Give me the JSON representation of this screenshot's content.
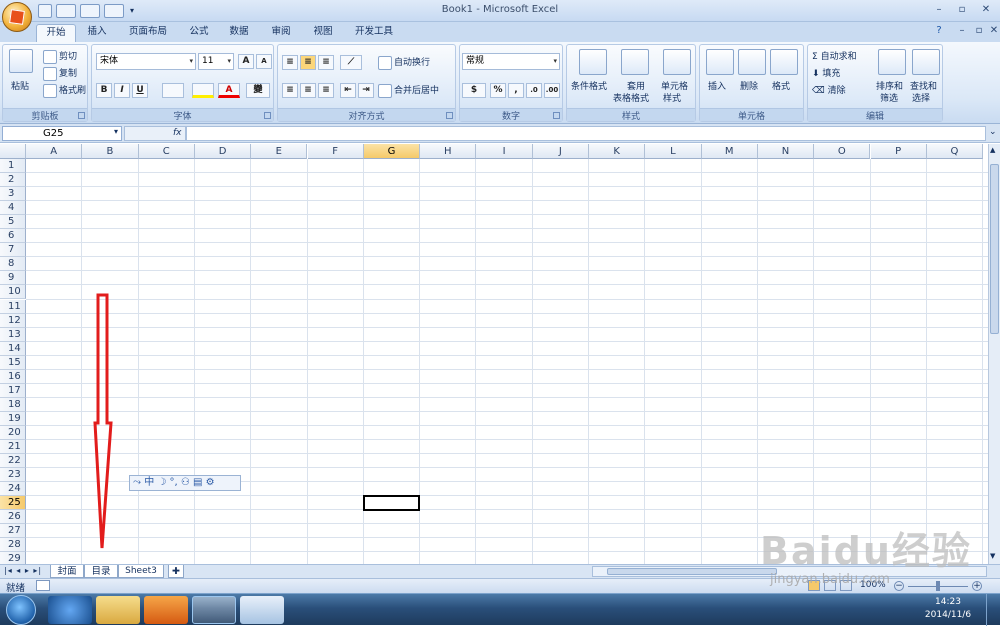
{
  "window": {
    "title": "Book1 - Microsoft Excel"
  },
  "tabs": [
    "开始",
    "插入",
    "页面布局",
    "公式",
    "数据",
    "审阅",
    "视图",
    "开发工具"
  ],
  "clipboard": {
    "paste": "粘贴",
    "cut": "剪切",
    "copy": "复制",
    "format_painter": "格式刷",
    "label": "剪贴板"
  },
  "font": {
    "name": "宋体",
    "size": "11",
    "bold": "B",
    "italic": "I",
    "underline": "U",
    "label": "字体",
    "pinyin": "變"
  },
  "alignment": {
    "wrap": "自动换行",
    "merge": "合并后居中",
    "label": "对齐方式"
  },
  "number": {
    "format": "常规",
    "percent": "%",
    "comma": ",",
    "label": "数字"
  },
  "styles": {
    "conditional": "条件格式",
    "table_format_1": "套用",
    "table_format_2": "表格格式",
    "cell_style_1": "单元格",
    "cell_style_2": "样式",
    "label": "样式"
  },
  "cells": {
    "insert": "插入",
    "delete": "删除",
    "format": "格式",
    "label": "单元格"
  },
  "editing": {
    "autosum": "自动求和",
    "fill": "填充",
    "clear": "清除",
    "sort_1": "排序和",
    "sort_2": "筛选",
    "find_1": "查找和",
    "find_2": "选择",
    "label": "编辑"
  },
  "formula_bar": {
    "name_box": "G25",
    "fx": "fx",
    "value": ""
  },
  "columns": [
    "A",
    "B",
    "C",
    "D",
    "E",
    "F",
    "G",
    "H",
    "I",
    "J",
    "K",
    "L",
    "M",
    "N",
    "O",
    "P",
    "Q"
  ],
  "rows": [
    "1",
    "2",
    "3",
    "4",
    "5",
    "6",
    "7",
    "8",
    "9",
    "10",
    "11",
    "12",
    "13",
    "14",
    "15",
    "16",
    "17",
    "18",
    "19",
    "20",
    "21",
    "22",
    "23",
    "24",
    "25",
    "26",
    "27",
    "28",
    "29"
  ],
  "selected": {
    "column": "G",
    "row": "25"
  },
  "sheets": [
    "封面",
    "目录",
    "Sheet3"
  ],
  "status": {
    "ready": "就绪",
    "zoom": "100%"
  },
  "ime": {
    "text": "中 ☽ °, ⚇ ▤ ⚙"
  },
  "taskbar": {
    "time": "14:23",
    "date": "2014/11/6"
  },
  "watermark": {
    "main": "Baidu经验",
    "sub": "jingyan.baidu.com"
  },
  "colors": {
    "selection_header": "#f5c96a",
    "arrow": "#e21c1c",
    "taskbar": "#2a4f7a"
  }
}
